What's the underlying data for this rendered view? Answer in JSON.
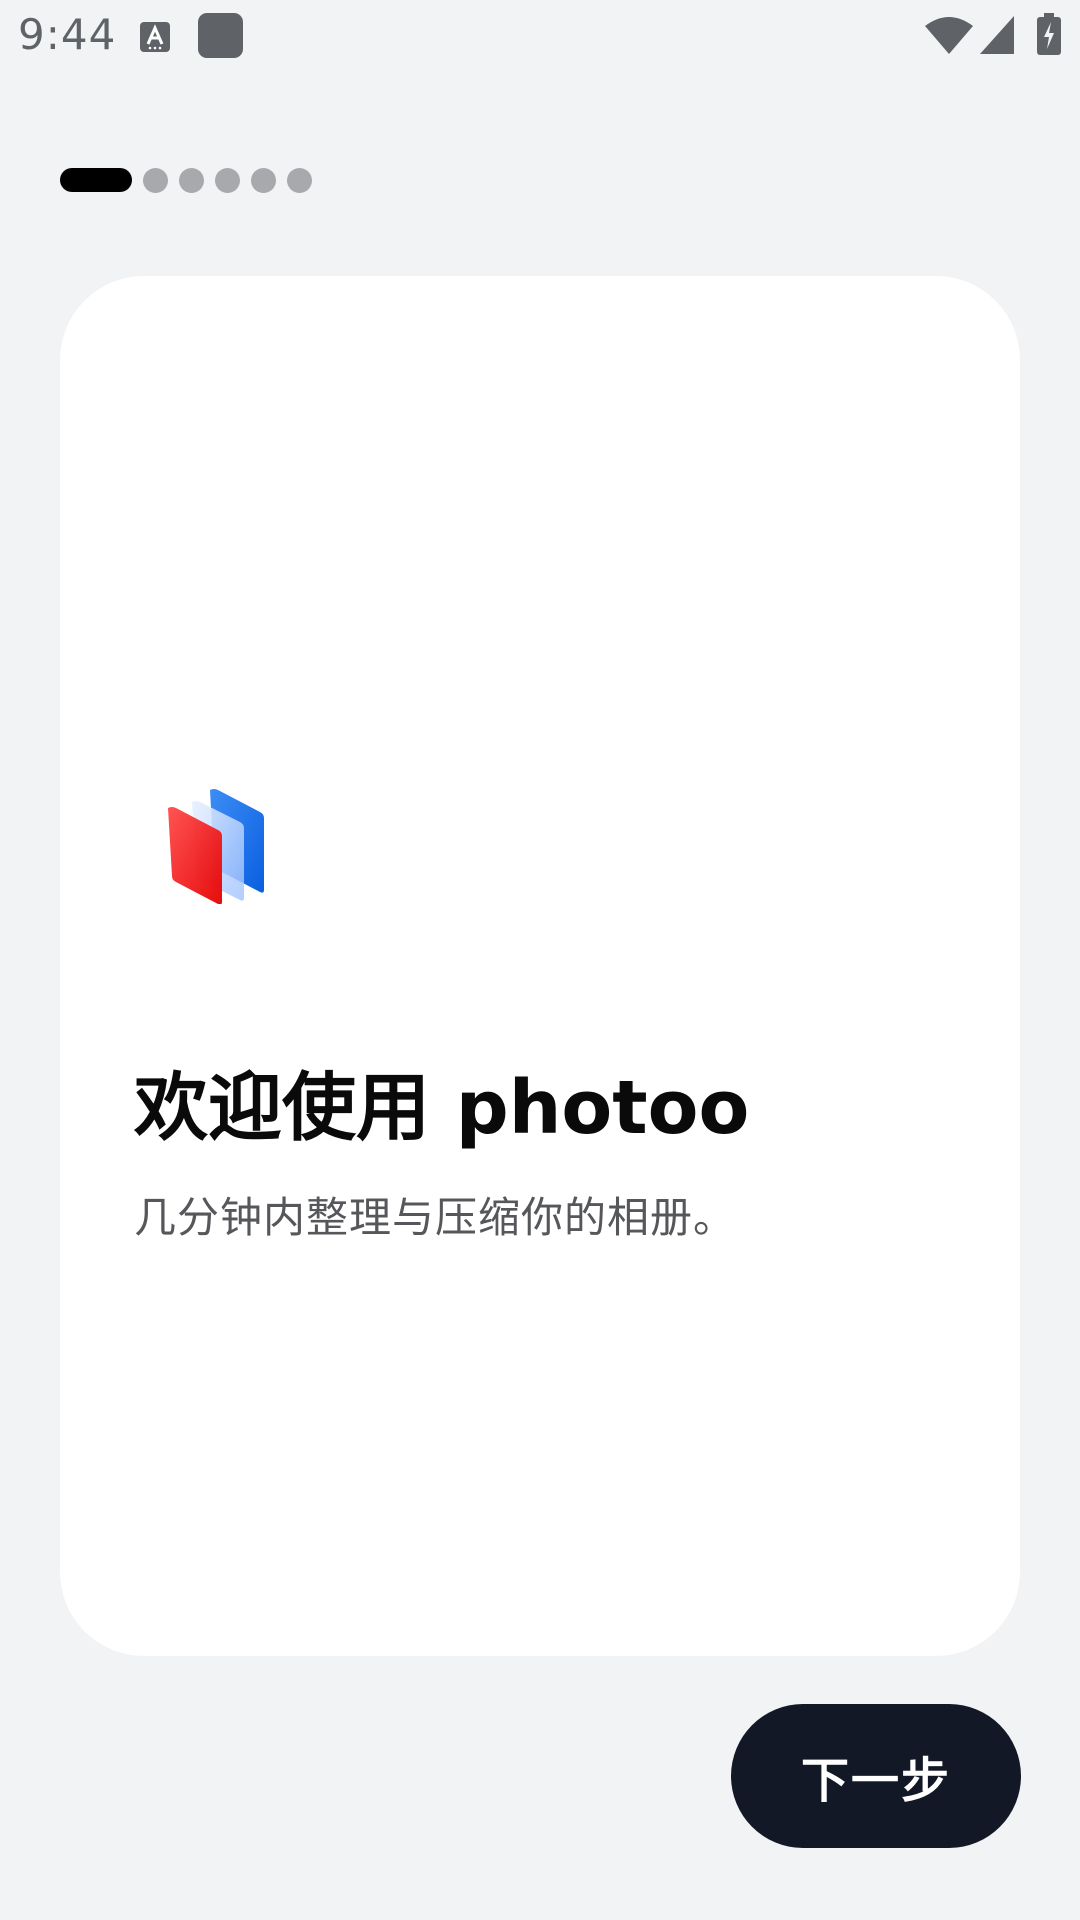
{
  "status_bar": {
    "time": "9:44",
    "icons": [
      "a-keyboard-icon",
      "app-square-icon",
      "wifi-icon",
      "signal-icon",
      "battery-charging-icon"
    ]
  },
  "onboarding": {
    "total_pages": 6,
    "current_page": 1
  },
  "welcome": {
    "title": "欢迎使用 photoo",
    "subtitle": "几分钟内整理与压缩你的相册。",
    "logo_icon": "photoo-logo-icon"
  },
  "actions": {
    "next_label": "下一步"
  },
  "colors": {
    "background": "#f2f3f5",
    "card": "#ffffff",
    "button": "#121826",
    "indicator_active": "#000000",
    "indicator_inactive": "#a7a9ad",
    "logo_red": "#ff2a2a",
    "logo_blue": "#1a73e8"
  }
}
